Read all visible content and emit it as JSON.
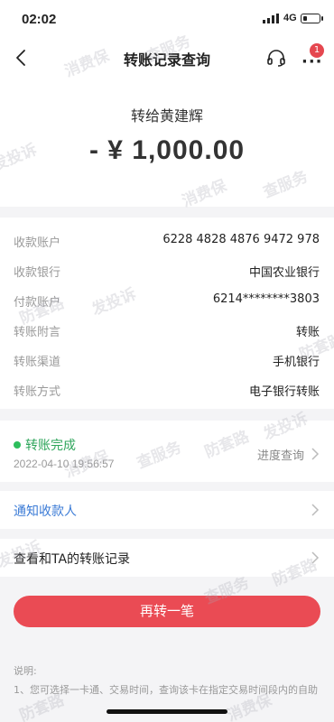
{
  "status_bar": {
    "time": "02:02",
    "network": "4G"
  },
  "nav": {
    "title": "转账记录查询",
    "badge_count": "1"
  },
  "summary": {
    "recipient_line": "转给黄建辉",
    "amount": "- ¥ 1,000.00"
  },
  "details": [
    {
      "label": "收款账户",
      "value": "6228 4828 4876 9472 978"
    },
    {
      "label": "收款银行",
      "value": "中国农业银行"
    },
    {
      "label": "付款账户",
      "value": "6214********3803"
    },
    {
      "label": "转账附言",
      "value": "转账"
    },
    {
      "label": "转账渠道",
      "value": "手机银行"
    },
    {
      "label": "转账方式",
      "value": "电子银行转账"
    }
  ],
  "status": {
    "text": "转账完成",
    "time": "2022-04-10 19:56:57",
    "progress_link": "进度查询",
    "color": "#2ea55b"
  },
  "notify": {
    "label": "通知收款人"
  },
  "history": {
    "label": "查看和TA的转账记录"
  },
  "again_button": {
    "label": "再转一笔",
    "color": "#ea4b54"
  },
  "note": {
    "title": "说明:",
    "line1": "1、您可选择一卡通、交易时间，查询该卡在指定交易时间段内的自助"
  },
  "watermarks": [
    "消费保",
    "查服务",
    "防套路",
    "发投诉"
  ],
  "icons": [
    "back-icon",
    "headset-icon",
    "more-icon",
    "chevron-right-icon",
    "signal-icon",
    "battery-icon"
  ]
}
